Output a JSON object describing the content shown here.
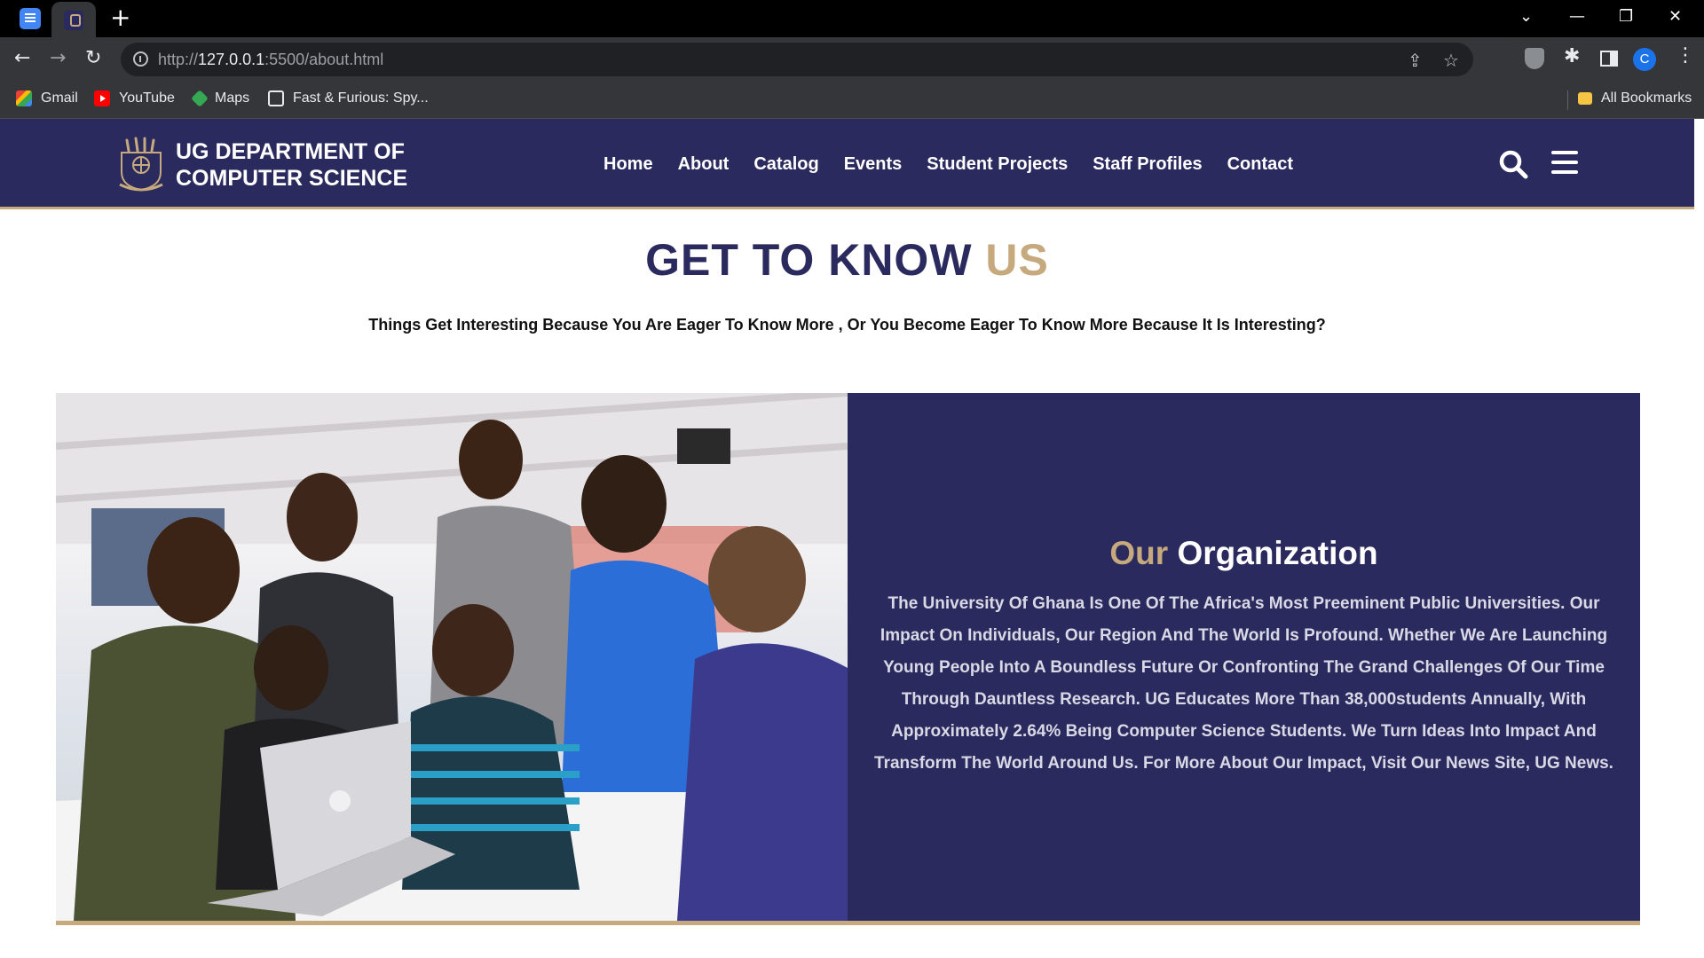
{
  "browser": {
    "url_scheme": "http://",
    "url_host": "127.0.0.1",
    "url_path": ":5500/about.html",
    "avatar_letter": "C",
    "bookmarks": [
      {
        "label": "Gmail",
        "icon": "gmail-icon"
      },
      {
        "label": "YouTube",
        "icon": "youtube-icon"
      },
      {
        "label": "Maps",
        "icon": "maps-icon"
      },
      {
        "label": "Fast & Furious: Spy...",
        "icon": "globe-icon"
      }
    ],
    "all_bookmarks": "All Bookmarks"
  },
  "site": {
    "brand_line1": "UG DEPARTMENT OF",
    "brand_line2": "COMPUTER SCIENCE",
    "menu": [
      "Home",
      "About",
      "Catalog",
      "Events",
      "Student Projects",
      "Staff Profiles",
      "Contact"
    ],
    "colors": {
      "primary": "#2b2a5e",
      "accent": "#c6a97d"
    }
  },
  "hero": {
    "title_main": "GET TO KNOW ",
    "title_accent": "US",
    "tagline": "Things Get Interesting Because You Are Eager To Know More , Or You Become Eager To Know More Because It Is Interesting?"
  },
  "organization": {
    "title_accent": "Our",
    "title_main": " Organization",
    "body": "The University Of Ghana Is One Of The Africa's Most Preeminent Public Universities. Our Impact On Individuals, Our Region And The World Is Profound. Whether We Are Launching Young People Into A Boundless Future Or Confronting The Grand Challenges Of Our Time Through Dauntless Research. UG Educates More Than 38,000students Annually, With Approximately 2.64% Being Computer Science Students. We Turn Ideas Into Impact And Transform The World Around Us. For More About Our Impact, Visit Our News Site, UG News."
  }
}
